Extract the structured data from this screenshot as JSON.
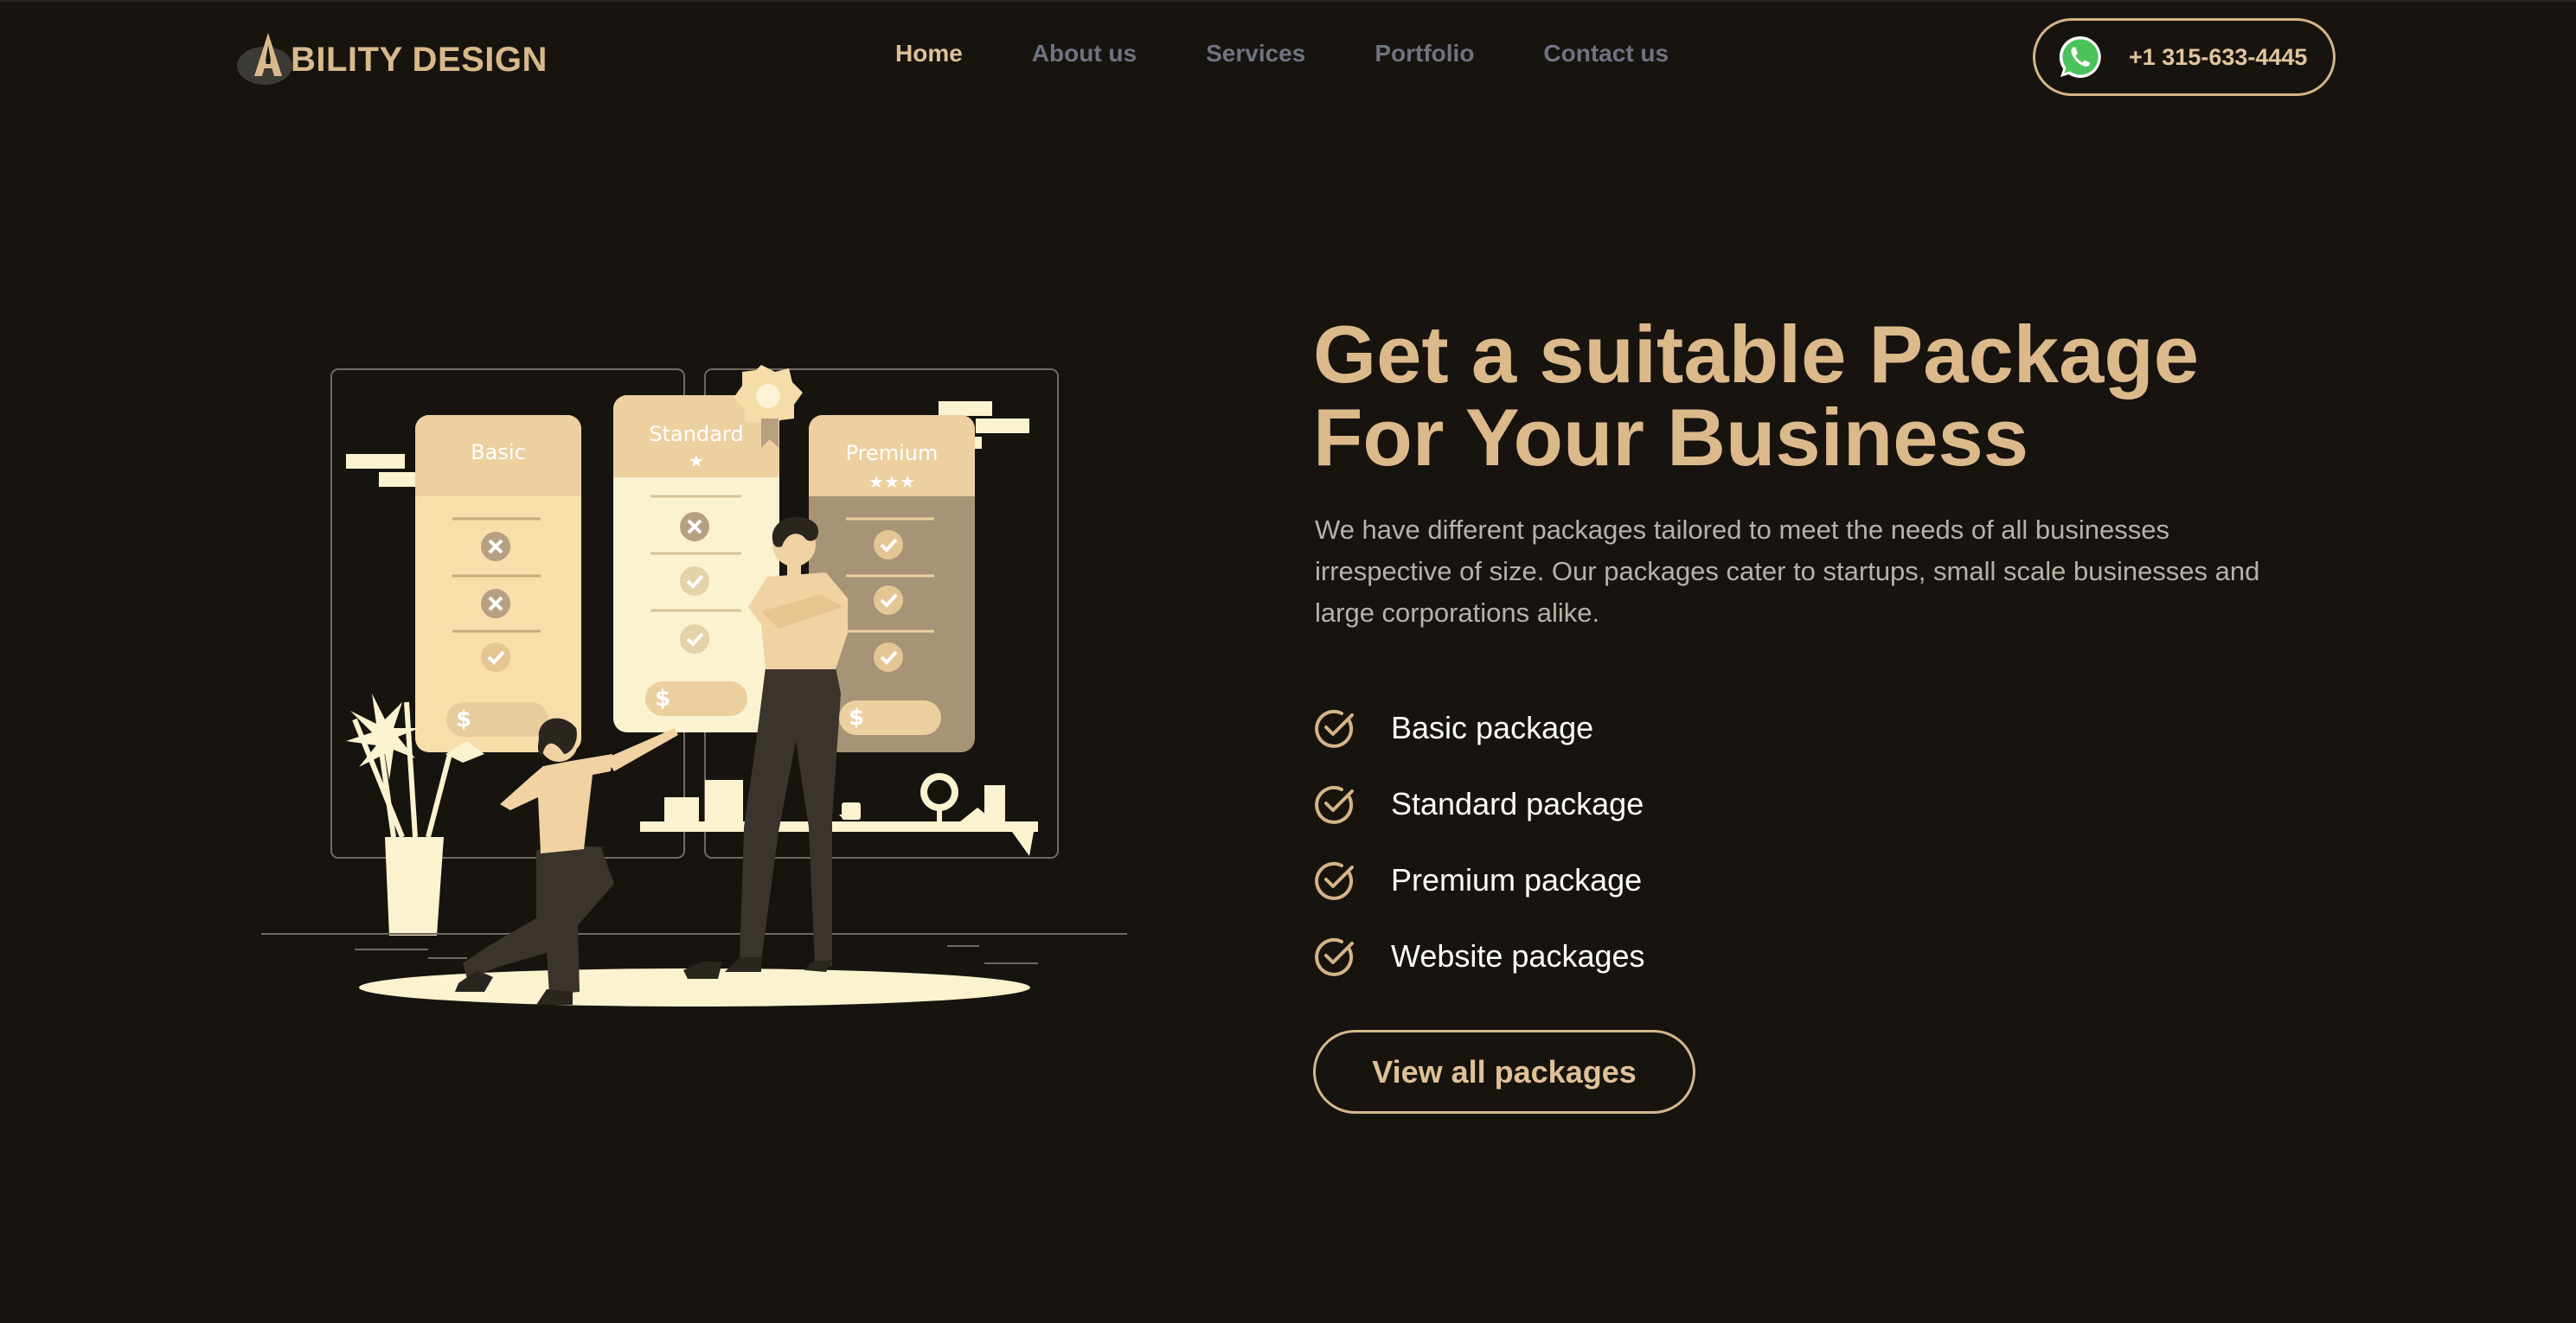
{
  "brand": {
    "name": "BILITY DESIGN",
    "logo_icon": "ability-a-icon",
    "accent_color": "#dbb98a",
    "background_color": "#17130f"
  },
  "nav": {
    "items": [
      {
        "label": "Home",
        "active": true
      },
      {
        "label": "About us",
        "active": false
      },
      {
        "label": "Services",
        "active": false
      },
      {
        "label": "Portfolio",
        "active": false
      },
      {
        "label": "Contact us",
        "active": false
      }
    ]
  },
  "contact": {
    "icon": "whatsapp-icon",
    "phone": "+1 315-633-4445"
  },
  "illustration": {
    "cards": [
      {
        "label": "Basic"
      },
      {
        "label": "Standard"
      },
      {
        "label": "Premium"
      }
    ],
    "currency_symbol": "$"
  },
  "hero": {
    "headline_line1": "Get a suitable Package",
    "headline_line2": "For Your Business",
    "description": "We have different packages tailored to meet the needs of all businesses irrespective of size. Our packages cater to startups, small scale businesses and large corporations alike.",
    "packages": [
      {
        "label": "Basic package",
        "icon": "check-circle-icon"
      },
      {
        "label": "Standard package",
        "icon": "check-circle-icon"
      },
      {
        "label": "Premium package",
        "icon": "check-circle-icon"
      },
      {
        "label": "Website packages",
        "icon": "check-circle-icon"
      }
    ],
    "cta_label": "View all packages"
  }
}
